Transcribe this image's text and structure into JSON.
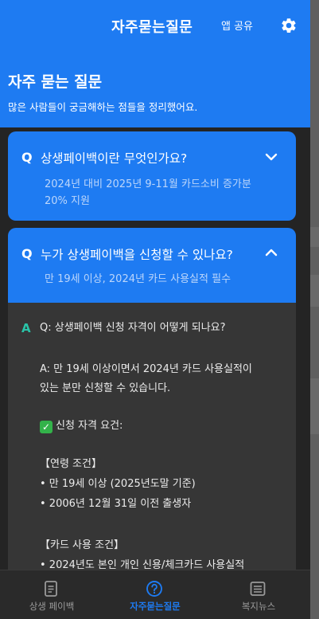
{
  "header": {
    "title": "자주묻는질문",
    "share_label": "앱 공유",
    "settings_icon": "gear-icon"
  },
  "intro": {
    "title": "자주 묻는 질문",
    "subtitle": "많은 사람들이 궁금해하는 점들을 정리했어요."
  },
  "faq": [
    {
      "q_mark": "Q",
      "question": "상생페이백이란 무엇인가요?",
      "summary": "2024년 대비 2025년 9-11월 카드소비 증가분 20% 지원",
      "expanded": false
    },
    {
      "q_mark": "Q",
      "question": "누가 상생페이백을 신청할 수 있나요?",
      "summary": "만 19세 이상, 2024년 카드 사용실적 필수",
      "expanded": true
    }
  ],
  "answer": {
    "a_mark": "A",
    "lines": [
      "Q: 상생페이백 신청 자격이 어떻게 되나요?",
      "A: 만 19세 이상이면서 2024년 카드 사용실적이",
      "있는 분만 신청할 수 있습니다.",
      "신청 자격 요건:",
      "【연령 조건】",
      "• 만 19세 이상 (2025년도말 기준)",
      "• 2006년 12월 31일 이전 출생자",
      "【카드 사용 조건】",
      "• 2024년도 본인 개인 신용/체크카드 사용실적"
    ]
  },
  "tabs": [
    {
      "label": "상생 페이백",
      "icon": "document-icon",
      "active": false
    },
    {
      "label": "자주묻는질문",
      "icon": "question-icon",
      "active": true
    },
    {
      "label": "복지뉴스",
      "icon": "news-icon",
      "active": false
    }
  ],
  "colors": {
    "primary": "#1e7bf2",
    "answer_bg": "#363636",
    "answer_mark": "#2ac3a8"
  }
}
